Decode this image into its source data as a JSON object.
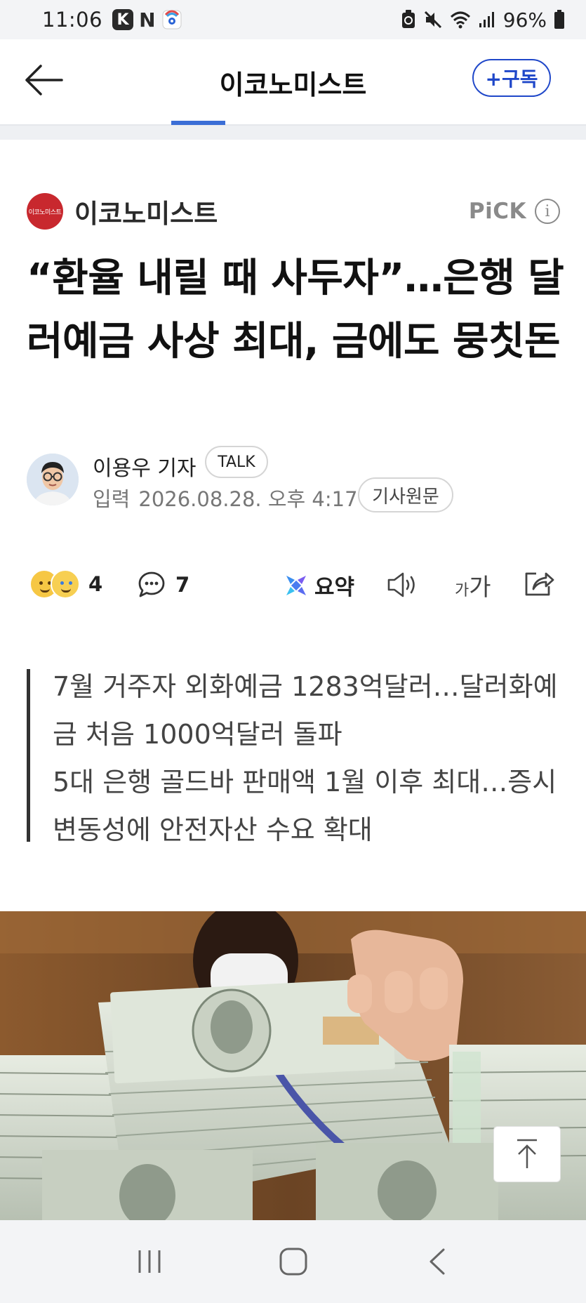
{
  "status_bar": {
    "time": "11:06",
    "app_k": "K",
    "app_n": "N",
    "battery_percent": "96%"
  },
  "header": {
    "title": "이코노미스트",
    "subscribe_label": "+구독"
  },
  "press": {
    "logo_text": "이코노미스트",
    "name": "이코노미스트",
    "pick_label": "PiCK",
    "info_glyph": "i"
  },
  "article": {
    "headline": "“환율 내릴 때 사두자”…은행 달러예금 사상 최대, 금에도 뭉칫돈",
    "reporter": "이용우 기자",
    "talk_label": "TALK",
    "date_label": "입력",
    "date": "2026.08.28. 오후 4:17",
    "original_label": "기사원문",
    "summary": [
      "7월 거주자 외화예금 1283억달러…달러화예금 처음 1000억달러 돌파",
      "5대 은행 골드바 판매액 1월 이후 최대…증시 변동성에 안전자산 수요 확대"
    ]
  },
  "actions": {
    "reaction_count": "4",
    "comment_count": "7",
    "summary_label": "요약",
    "font_small": "가",
    "font_big": "가"
  },
  "colors": {
    "accent_blue": "#1f47c9",
    "tab_indicator": "#3b6ed6",
    "press_logo_red": "#c8282e"
  }
}
